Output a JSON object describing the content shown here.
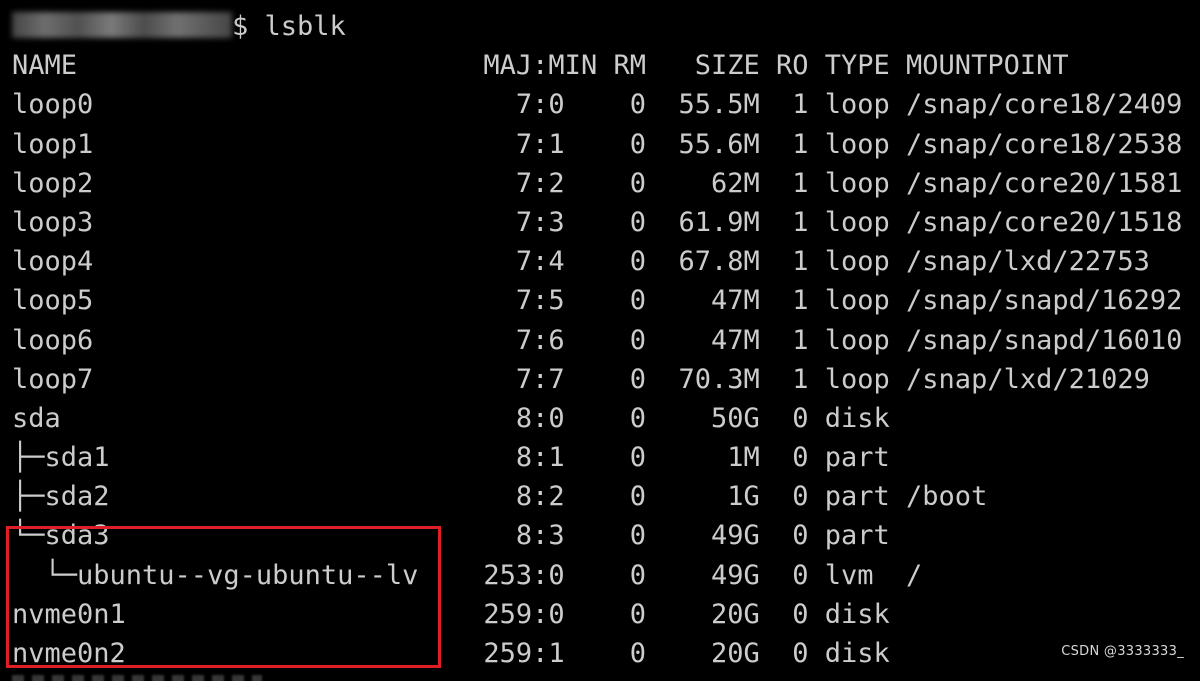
{
  "prompt": {
    "command": "$ lsblk"
  },
  "lsblk": {
    "header": "NAME                         MAJ:MIN RM   SIZE RO TYPE MOUNTPOINT",
    "rows": [
      "loop0                          7:0    0  55.5M  1 loop /snap/core18/2409",
      "loop1                          7:1    0  55.6M  1 loop /snap/core18/2538",
      "loop2                          7:2    0    62M  1 loop /snap/core20/1581",
      "loop3                          7:3    0  61.9M  1 loop /snap/core20/1518",
      "loop4                          7:4    0  67.8M  1 loop /snap/lxd/22753",
      "loop5                          7:5    0    47M  1 loop /snap/snapd/16292",
      "loop6                          7:6    0    47M  1 loop /snap/snapd/16010",
      "loop7                          7:7    0  70.3M  1 loop /snap/lxd/21029",
      "sda                            8:0    0    50G  0 disk",
      "├─sda1                         8:1    0     1M  0 part",
      "├─sda2                         8:2    0     1G  0 part /boot",
      "└─sda3                         8:3    0    49G  0 part",
      "  └─ubuntu--vg-ubuntu--lv    253:0    0    49G  0 lvm  /",
      "nvme0n1                      259:0    0    20G  0 disk",
      "nvme0n2                      259:1    0    20G  0 disk"
    ]
  },
  "watermark": "CSDN @3333333_",
  "colors": {
    "background": "#000000",
    "text": "#cccccc",
    "highlight_border": "#e01e25"
  }
}
